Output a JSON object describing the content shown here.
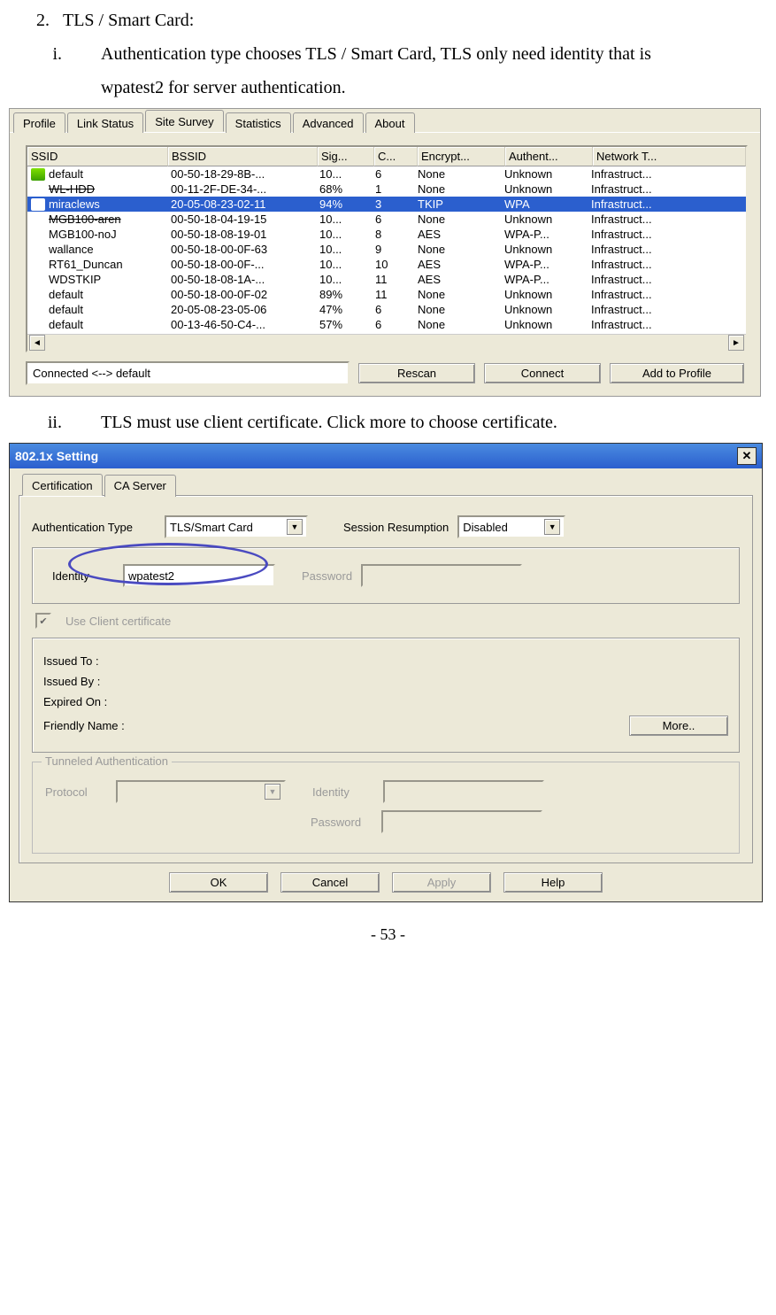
{
  "doc": {
    "item_num": "2.",
    "item_title": "TLS / Smart Card:",
    "sub_i_num": "i.",
    "sub_i_text_a": "Authentication type chooses TLS / Smart Card, TLS only need identity that is",
    "sub_i_text_b": "wpatest2 for server authentication.",
    "sub_ii_num": "ii.",
    "sub_ii_text": "TLS must use client certificate. Click more to choose certificate.",
    "page_number": "- 53 -"
  },
  "survey": {
    "tabs": [
      "Profile",
      "Link Status",
      "Site Survey",
      "Statistics",
      "Advanced",
      "About"
    ],
    "active_tab": 2,
    "headers": [
      "SSID",
      "BSSID",
      "Sig...",
      "C...",
      "Encrypt...",
      "Authent...",
      "Network T..."
    ],
    "rows": [
      {
        "ssid": "default",
        "bssid": "00-50-18-29-8B-...",
        "sig": "10...",
        "ch": "6",
        "enc": "None",
        "auth": "Unknown",
        "net": "Infrastruct...",
        "icon": true,
        "strike": false
      },
      {
        "ssid": "WL-HDD",
        "bssid": "00-11-2F-DE-34-...",
        "sig": "68%",
        "ch": "1",
        "enc": "None",
        "auth": "Unknown",
        "net": "Infrastruct...",
        "icon": false,
        "strike": true
      },
      {
        "ssid": "miraclews",
        "bssid": "20-05-08-23-02-11",
        "sig": "94%",
        "ch": "3",
        "enc": "TKIP",
        "auth": "WPA",
        "net": "Infrastruct...",
        "icon": false,
        "strike": false,
        "selected": true
      },
      {
        "ssid": "MGB100-aren",
        "bssid": "00-50-18-04-19-15",
        "sig": "10...",
        "ch": "6",
        "enc": "None",
        "auth": "Unknown",
        "net": "Infrastruct...",
        "icon": false,
        "strike": true
      },
      {
        "ssid": "MGB100-noJ",
        "bssid": "00-50-18-08-19-01",
        "sig": "10...",
        "ch": "8",
        "enc": "AES",
        "auth": "WPA-P...",
        "net": "Infrastruct...",
        "icon": false,
        "strike": false
      },
      {
        "ssid": "wallance",
        "bssid": "00-50-18-00-0F-63",
        "sig": "10...",
        "ch": "9",
        "enc": "None",
        "auth": "Unknown",
        "net": "Infrastruct...",
        "icon": false,
        "strike": false
      },
      {
        "ssid": "RT61_Duncan",
        "bssid": "00-50-18-00-0F-...",
        "sig": "10...",
        "ch": "10",
        "enc": "AES",
        "auth": "WPA-P...",
        "net": "Infrastruct...",
        "icon": false,
        "strike": false
      },
      {
        "ssid": "WDSTKIP",
        "bssid": "00-50-18-08-1A-...",
        "sig": "10...",
        "ch": "11",
        "enc": "AES",
        "auth": "WPA-P...",
        "net": "Infrastruct...",
        "icon": false,
        "strike": false
      },
      {
        "ssid": "default",
        "bssid": "00-50-18-00-0F-02",
        "sig": "89%",
        "ch": "11",
        "enc": "None",
        "auth": "Unknown",
        "net": "Infrastruct...",
        "icon": false,
        "strike": false
      },
      {
        "ssid": "default",
        "bssid": "20-05-08-23-05-06",
        "sig": "47%",
        "ch": "6",
        "enc": "None",
        "auth": "Unknown",
        "net": "Infrastruct...",
        "icon": false,
        "strike": false
      },
      {
        "ssid": "default",
        "bssid": "00-13-46-50-C4-...",
        "sig": "57%",
        "ch": "6",
        "enc": "None",
        "auth": "Unknown",
        "net": "Infrastruct...",
        "icon": false,
        "strike": false
      }
    ],
    "status": "Connected <--> default",
    "btn_rescan": "Rescan",
    "btn_connect": "Connect",
    "btn_add": "Add to Profile"
  },
  "dlg": {
    "title": "802.1x Setting",
    "tabs": [
      "Certification",
      "CA Server"
    ],
    "active_tab": 0,
    "auth_type_label": "Authentication Type",
    "auth_type_value": "TLS/Smart Card",
    "session_label": "Session Resumption",
    "session_value": "Disabled",
    "identity_label": "Identity",
    "identity_value": "wpatest2",
    "password_label": "Password",
    "use_client_cert": "Use Client certificate",
    "issued_to": "Issued To :",
    "issued_by": "Issued By :",
    "expired_on": "Expired On :",
    "friendly_name": "Friendly Name :",
    "more": "More..",
    "tunneled_legend": "Tunneled Authentication",
    "protocol_label": "Protocol",
    "t_identity_label": "Identity",
    "t_password_label": "Password",
    "btn_ok": "OK",
    "btn_cancel": "Cancel",
    "btn_apply": "Apply",
    "btn_help": "Help"
  }
}
